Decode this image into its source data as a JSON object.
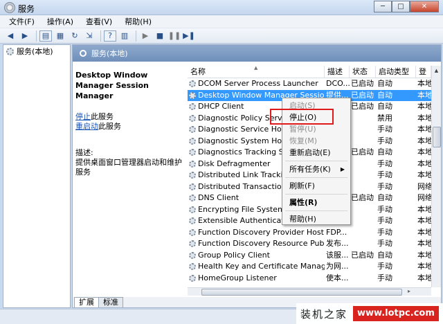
{
  "window": {
    "title": "服务",
    "minimize": "─",
    "maximize": "□",
    "close": "✕"
  },
  "menubar": [
    "文件(F)",
    "操作(A)",
    "查看(V)",
    "帮助(H)"
  ],
  "tree": {
    "root_label": "服务(本地)"
  },
  "content": {
    "header": "服务(本地)",
    "service_title": "Desktop Window Manager Session Manager",
    "action_stop_link": "停止",
    "action_stop_suffix": "此服务",
    "action_restart_link": "重启动",
    "action_restart_suffix": "此服务",
    "desc_label": "描述:",
    "desc_text": "提供桌面窗口管理器启动和维护服务"
  },
  "table": {
    "columns": [
      "名称",
      "描述",
      "状态",
      "启动类型",
      "登"
    ],
    "rows": [
      {
        "name": "DCOM Server Process Launcher",
        "desc": "DCO...",
        "status": "已启动",
        "startup": "自动",
        "logon": "本地"
      },
      {
        "name": "Desktop Window Manager Session",
        "desc": "提供...",
        "status": "已启动",
        "startup": "自动",
        "logon": "本地"
      },
      {
        "name": "DHCP Client",
        "desc": "",
        "status": "已启动",
        "startup": "自动",
        "logon": "本地"
      },
      {
        "name": "Diagnostic Policy Servi",
        "desc": "",
        "status": "",
        "startup": "禁用",
        "logon": "本地"
      },
      {
        "name": "Diagnostic Service Hos",
        "desc": "",
        "status": "",
        "startup": "手动",
        "logon": "本地"
      },
      {
        "name": "Diagnostic System Hos",
        "desc": "",
        "status": "",
        "startup": "手动",
        "logon": "本地"
      },
      {
        "name": "Diagnostics Tracking S",
        "desc": "",
        "status": "已启动",
        "startup": "自动",
        "logon": "本地"
      },
      {
        "name": "Disk Defragmenter",
        "desc": "",
        "status": "",
        "startup": "手动",
        "logon": "本地"
      },
      {
        "name": "Distributed Link Tracki",
        "desc": "",
        "status": "",
        "startup": "手动",
        "logon": "本地"
      },
      {
        "name": "Distributed Transactio",
        "desc": "",
        "status": "",
        "startup": "手动",
        "logon": "网络"
      },
      {
        "name": "DNS Client",
        "desc": "",
        "status": "已启动",
        "startup": "自动",
        "logon": "网络"
      },
      {
        "name": "Encrypting File System",
        "desc": "",
        "status": "",
        "startup": "手动",
        "logon": "本地"
      },
      {
        "name": "Extensible Authenticati",
        "desc": "",
        "status": "",
        "startup": "手动",
        "logon": "本地"
      },
      {
        "name": "Function Discovery Provider Host",
        "desc": "FDP...",
        "status": "",
        "startup": "手动",
        "logon": "本地"
      },
      {
        "name": "Function Discovery Resource Publicati...",
        "desc": "发布...",
        "status": "",
        "startup": "手动",
        "logon": "本地"
      },
      {
        "name": "Group Policy Client",
        "desc": "该服...",
        "status": "已启动",
        "startup": "自动",
        "logon": "本地"
      },
      {
        "name": "Health Key and Certificate Manageme...",
        "desc": "为网...",
        "status": "",
        "startup": "手动",
        "logon": "本地"
      },
      {
        "name": "HomeGroup Listener",
        "desc": "使本...",
        "status": "",
        "startup": "手动",
        "logon": "本地"
      }
    ]
  },
  "context_menu": {
    "items": [
      {
        "label": "启动(S)",
        "disabled": true
      },
      {
        "label": "停止(O)",
        "disabled": false
      },
      {
        "label": "暂停(U)",
        "disabled": true
      },
      {
        "label": "恢复(M)",
        "disabled": true
      },
      {
        "label": "重新启动(E)",
        "disabled": false
      },
      {
        "label": "所有任务(K)",
        "disabled": false,
        "submenu": true
      },
      {
        "label": "刷新(F)",
        "disabled": false
      },
      {
        "label": "属性(R)",
        "disabled": false,
        "bold": true
      },
      {
        "label": "帮助(H)",
        "disabled": false
      }
    ]
  },
  "tabs": [
    "扩展",
    "标准"
  ],
  "watermark": {
    "text": "装机之家",
    "url": "www.lotpc.com"
  }
}
